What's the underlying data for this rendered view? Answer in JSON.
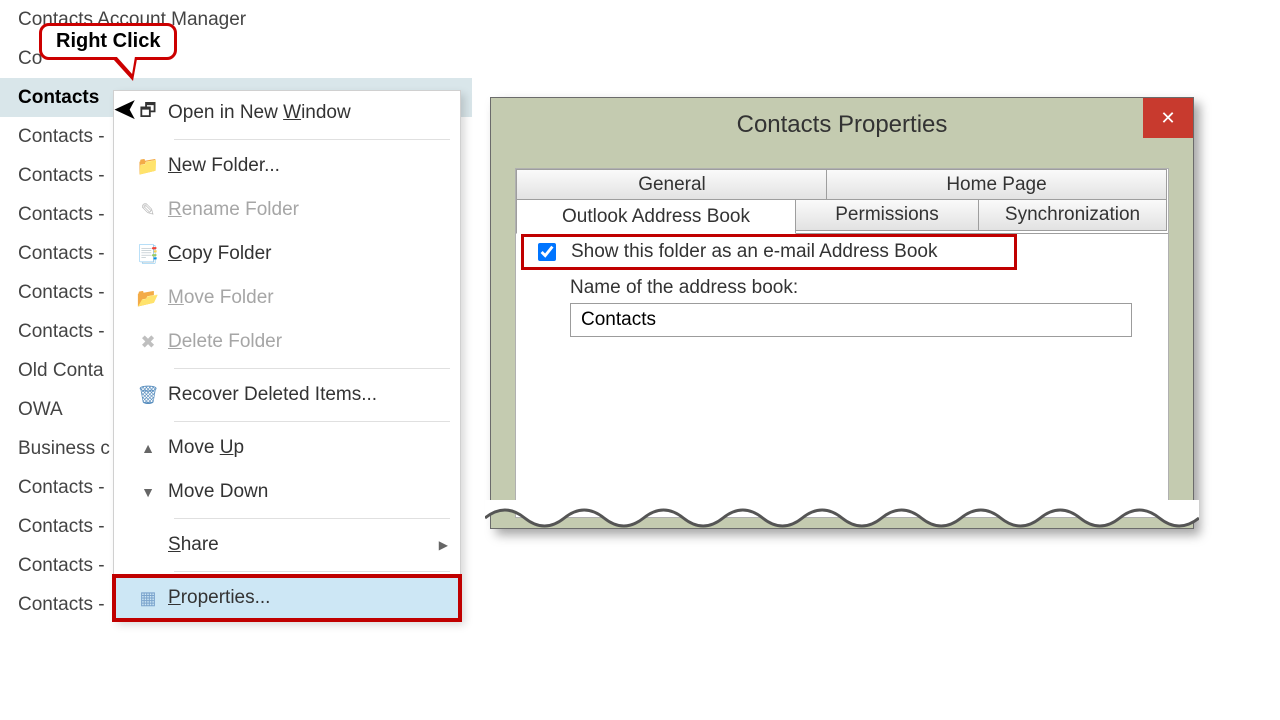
{
  "tooltip": {
    "text": "Right Click"
  },
  "folders": {
    "items": [
      "Contacts  Account Manager",
      "Co",
      "Contacts",
      "Contacts -",
      "Contacts -",
      "Contacts -",
      "Contacts -",
      "Contacts -",
      "Contacts -",
      "Old Conta",
      "OWA",
      "Business c",
      "Contacts -",
      "Contacts -",
      "Contacts -",
      "Contacts -"
    ],
    "selected_index": 2
  },
  "menu": {
    "open_new_window": "Open in New Window",
    "new_folder": "New Folder...",
    "rename_folder": "Rename Folder",
    "copy_folder": "Copy Folder",
    "move_folder": "Move Folder",
    "delete_folder": "Delete Folder",
    "recover_deleted": "Recover Deleted Items...",
    "move_up": "Move Up",
    "move_down": "Move Down",
    "share": "Share",
    "properties": "Properties..."
  },
  "dialog": {
    "title": "Contacts Properties",
    "close": "✕",
    "tabs": {
      "general": "General",
      "home_page": "Home Page",
      "outlook_ab": "Outlook Address Book",
      "permissions": "Permissions",
      "synchronization": "Synchronization"
    },
    "show_as_ab_label": "Show this folder as an e-mail Address Book",
    "show_as_ab_checked": true,
    "name_label": "Name of the address book:",
    "name_value": "Contacts"
  },
  "icons": {
    "open_window": "🗗",
    "folder": "📁",
    "rename": "✎",
    "copy": "📑",
    "move": "📂",
    "delete": "✖",
    "recover": "🗑",
    "up": "▲",
    "down": "▼",
    "properties": "▦",
    "submenu": "▶"
  }
}
